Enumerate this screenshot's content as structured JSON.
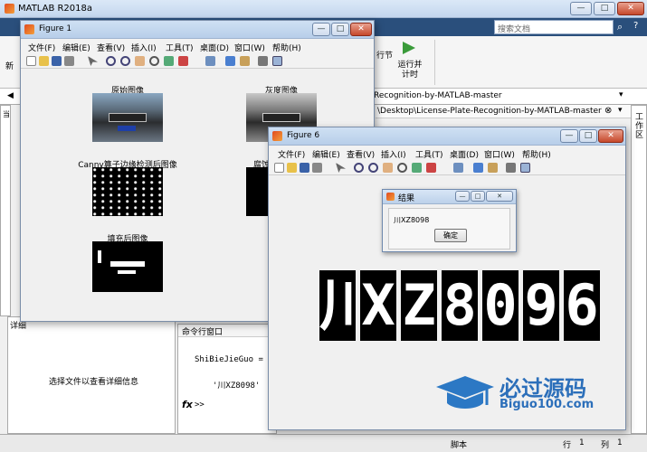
{
  "matlab": {
    "title": "MATLAB R2018a",
    "search_placeholder": "搜索文档",
    "toolbar_run_section": "行节",
    "toolbar_run_time": "运行并计时",
    "toolbar_new_fragment": "新",
    "path_text": "Recognition-by-MATLAB-master",
    "current_folder_path": "\\Desktop\\License-Plate-Recognition-by-MATLAB-master\\Ch...",
    "current_folder_label": "当",
    "workspace_label": "工作区",
    "details_label": "详细",
    "details_text": "选择文件以查看详细信息",
    "command_window_title": "命令行窗口",
    "cmd_line1": "ShiBieJieGuo =",
    "cmd_line2": "'川XZ8098'",
    "cmd_prompt": ">>",
    "fx": "fx",
    "status_script": "脚本",
    "status_row_label": "行",
    "status_row": "1",
    "status_col_label": "列",
    "status_col": "1",
    "colors": {
      "accent": "#2a4f7c",
      "title_bar": "#c3d6ee"
    }
  },
  "figure1": {
    "title": "Figure 1",
    "menu": [
      "文件(F)",
      "编辑(E)",
      "查看(V)",
      "插入(I)",
      "工具(T)",
      "桌面(D)",
      "窗口(W)",
      "帮助(H)"
    ],
    "captions": {
      "original": "原始图像",
      "gray": "灰度图像",
      "canny": "Canny算子边缘检测后图像",
      "erode": "腐蚀",
      "fill": "填充后图像"
    }
  },
  "figure6": {
    "title": "Figure 6",
    "menu": [
      "文件(F)",
      "编辑(E)",
      "查看(V)",
      "插入(I)",
      "工具(T)",
      "桌面(D)",
      "窗口(W)",
      "帮助(H)"
    ],
    "characters": [
      "川",
      "X",
      "Z",
      "8",
      "0",
      "9",
      "6"
    ]
  },
  "dialog": {
    "title": "结果",
    "message": "川XZ8098",
    "ok_label": "确定"
  },
  "watermark": {
    "text": "必过源码",
    "url": "Biguo100.com"
  }
}
